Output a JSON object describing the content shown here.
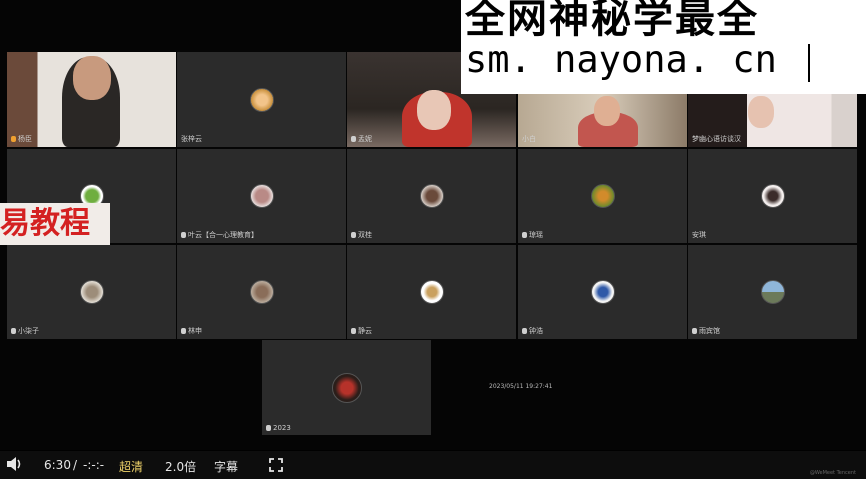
{
  "banner": {
    "line1": "全网神秘学最全",
    "line2": "sm. nayona. cn"
  },
  "watermark": {
    "text": "易教程"
  },
  "tiles": [
    {
      "id": "t1",
      "name": "杨臣",
      "video": true
    },
    {
      "id": "t2",
      "name": "张梓云",
      "video": false
    },
    {
      "id": "t3",
      "name": "孟妮",
      "video": true
    },
    {
      "id": "t4",
      "name": "小白",
      "video": true
    },
    {
      "id": "t5",
      "name": "梦幽心语访谈汉",
      "video": true
    },
    {
      "id": "t6",
      "name": "",
      "video": false
    },
    {
      "id": "t7",
      "name": "叶云【合一心理教育】",
      "video": false
    },
    {
      "id": "t8",
      "name": "双桂",
      "video": false
    },
    {
      "id": "t9",
      "name": "琼瑶",
      "video": false
    },
    {
      "id": "t10",
      "name": "安琪",
      "video": false
    },
    {
      "id": "t11",
      "name": "小柒子",
      "video": false
    },
    {
      "id": "t12",
      "name": "林申",
      "video": false
    },
    {
      "id": "t13",
      "name": "静云",
      "video": false
    },
    {
      "id": "t14",
      "name": "钟浩",
      "video": false
    },
    {
      "id": "t15",
      "name": "雨宾馆",
      "video": false
    },
    {
      "id": "t16",
      "name": "2023",
      "video": false
    }
  ],
  "timestamp": "2023/05/11 19:27:41",
  "player": {
    "time": "6:30",
    "separator": "/",
    "duration": "-:-:-",
    "quality": "超清",
    "speed": "2.0倍",
    "subtitles": "字幕"
  },
  "corner_tag": "@WeMeet Tencent",
  "icons": {
    "volume": "volume-icon",
    "fullscreen": "fullscreen-icon",
    "mic": "mic-icon",
    "avatar": "avatar-icon"
  }
}
